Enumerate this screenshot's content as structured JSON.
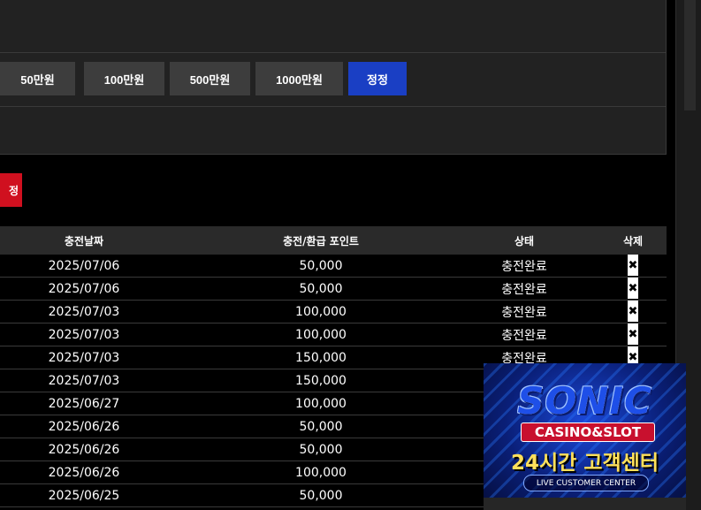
{
  "amount_buttons": [
    {
      "label": "50만원"
    },
    {
      "label": "100만원"
    },
    {
      "label": "500만원"
    },
    {
      "label": "1000만원"
    },
    {
      "label": "정정"
    }
  ],
  "red_button": {
    "label": "정"
  },
  "table": {
    "headers": {
      "date": "충전날짜",
      "point": "충전/환급 포인트",
      "status": "상태",
      "delete": "삭제"
    },
    "delete_symbol": "✖",
    "rows": [
      {
        "date": "2025/07/06",
        "point": "50,000",
        "status": "충전완료"
      },
      {
        "date": "2025/07/06",
        "point": "50,000",
        "status": "충전완료"
      },
      {
        "date": "2025/07/03",
        "point": "100,000",
        "status": "충전완료"
      },
      {
        "date": "2025/07/03",
        "point": "100,000",
        "status": "충전완료"
      },
      {
        "date": "2025/07/03",
        "point": "150,000",
        "status": "충전완료"
      },
      {
        "date": "2025/07/03",
        "point": "150,000",
        "status": ""
      },
      {
        "date": "2025/06/27",
        "point": "100,000",
        "status": ""
      },
      {
        "date": "2025/06/26",
        "point": "50,000",
        "status": ""
      },
      {
        "date": "2025/06/26",
        "point": "50,000",
        "status": ""
      },
      {
        "date": "2025/06/26",
        "point": "100,000",
        "status": ""
      },
      {
        "date": "2025/06/25",
        "point": "50,000",
        "status": ""
      }
    ]
  },
  "banner": {
    "brand": "SONIC",
    "tag": "CASINO&SLOT",
    "slogan": "24시간 고객센터",
    "subtitle": "LIVE CUSTOMER CENTER"
  }
}
